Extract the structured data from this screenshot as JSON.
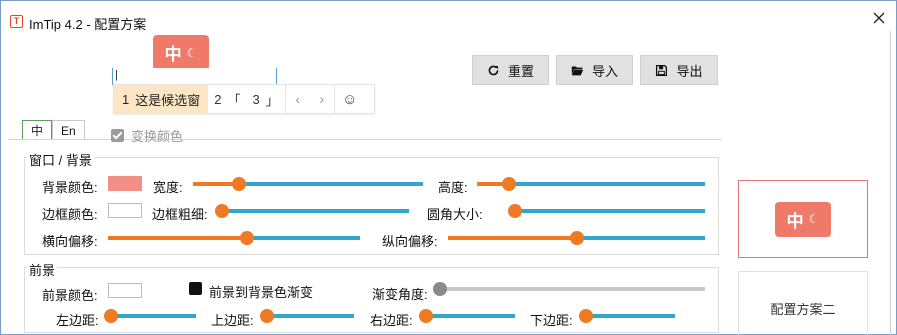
{
  "window": {
    "title": "ImTip 4.2 - 配置方案",
    "app_icon": "T",
    "close": "✕"
  },
  "ime_preview": {
    "lang": "中",
    "moon": "☾"
  },
  "test_input": {
    "value": "|"
  },
  "candidates": {
    "selected_index": "1",
    "selected_text": "这是候选窗",
    "items": [
      {
        "index": "2",
        "text": "「"
      },
      {
        "index": "3",
        "text": "」"
      }
    ],
    "prev": "‹",
    "next": "›",
    "emoji": "☺"
  },
  "toolbar": {
    "reset_label": "重置",
    "import_label": "导入",
    "export_label": "导出"
  },
  "tabs": [
    {
      "label": "中"
    },
    {
      "label": "En"
    }
  ],
  "swap_colors": {
    "label": "变换颜色",
    "checked": true
  },
  "window_group": {
    "title": "窗口 / 背景",
    "bg_color_label": "背景颜色:",
    "bg_color": "#f29088",
    "width_label": "宽度:",
    "height_label": "高度:",
    "border_color_label": "边框颜色:",
    "border_width_label": "边框粗细:",
    "radius_label": "圆角大小:",
    "offset_x_label": "横向偏移:",
    "offset_y_label": "纵向偏移:",
    "width_level": 0.2,
    "height_level": 0.14,
    "border_width_level": 0.02,
    "radius_level": 0.02,
    "offset_x_level": 0.55,
    "offset_y_level": 0.5
  },
  "fore_group": {
    "title": "前景",
    "fg_color_label": "前景颜色:",
    "gradient_label": "前景到背景色渐变",
    "gradient_angle_label": "渐变角度:",
    "gradient_angle_level": 0.0,
    "pad_left_label": "左边距:",
    "pad_top_label": "上边距:",
    "pad_right_label": "右边距:",
    "pad_bottom_label": "下边距:",
    "pad_left_level": 0.05,
    "pad_top_level": 0.05,
    "pad_right_level": 0.05,
    "pad_bottom_level": 0.05
  },
  "preview": {
    "lang": "中",
    "moon": "☾"
  },
  "scheme2": {
    "label": "配置方案二"
  },
  "colors": {
    "accent_orange": "#f07a24",
    "track_blue": "#33a6cc",
    "badge": "#f07a6a"
  }
}
